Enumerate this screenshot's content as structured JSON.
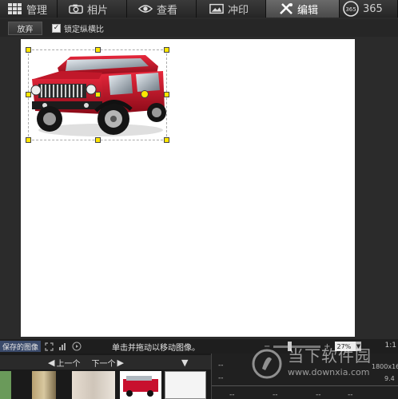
{
  "topnav": {
    "tabs": [
      {
        "label": "管理",
        "icon": "grid-icon"
      },
      {
        "label": "相片",
        "icon": "camera-icon"
      },
      {
        "label": "查看",
        "icon": "eye-icon"
      },
      {
        "label": "冲印",
        "icon": "print-icon"
      },
      {
        "label": "编辑",
        "icon": "edit-tools-icon",
        "active": true
      },
      {
        "label": "365",
        "icon": "365-badge-icon"
      }
    ]
  },
  "toolbar": {
    "discard_label": "放弃",
    "lock_ratio_label": "锁定纵横比",
    "lock_ratio_checked": true
  },
  "status": {
    "saved_images_label": "保存的图像",
    "hint": "单击并拖动以移动图像。",
    "zoom_value": "27%",
    "ratio": "1:1"
  },
  "filmstrip": {
    "prev_label": "上一个",
    "next_label": "下一个"
  },
  "info": {
    "dash": "--",
    "dimensions": "1800x16",
    "value": "9.4"
  },
  "watermark": {
    "line1": "当下软件园",
    "line2": "www.downxia.com"
  },
  "colors": {
    "accent_yellow": "#ffe600",
    "vehicle_red": "#c8102e"
  }
}
